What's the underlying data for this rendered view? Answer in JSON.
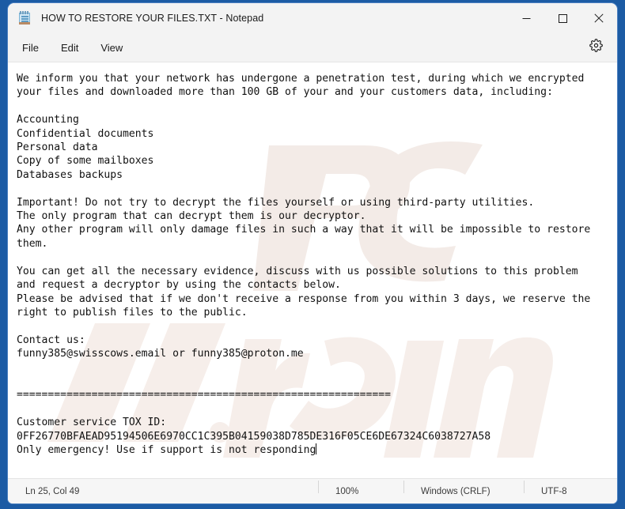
{
  "window": {
    "title": "HOW TO RESTORE YOUR FILES.TXT - Notepad",
    "app_icon": "notepad-icon",
    "controls": {
      "minimize": "minimize-icon",
      "maximize": "maximize-icon",
      "close": "close-icon"
    }
  },
  "menubar": {
    "items": [
      {
        "label": "File"
      },
      {
        "label": "Edit"
      },
      {
        "label": "View"
      }
    ],
    "settings_icon": "gear-icon"
  },
  "watermark": {
    "logo": "PC",
    "text": "risk.com",
    "color": "#f2ece9"
  },
  "document": {
    "lines": [
      "We inform you that your network has undergone a penetration test, during which we encrypted",
      "your files and downloaded more than 100 GB of your and your customers data, including:",
      "",
      "Accounting",
      "Confidential documents",
      "Personal data",
      "Copy of some mailboxes",
      "Databases backups",
      "",
      "Important! Do not try to decrypt the files yourself or using third-party utilities.",
      "The only program that can decrypt them is our decryptor.",
      "Any other program will only damage files in such a way that it will be impossible to restore",
      "them.",
      "",
      "You can get all the necessary evidence, discuss with us possible solutions to this problem",
      "and request a decryptor by using the contacts below.",
      "Please be advised that if we don't receive a response from you within 3 days, we reserve the",
      "right to publish files to the public.",
      "",
      "Contact us:",
      "funny385@swisscows.email or funny385@proton.me",
      "",
      "",
      "============================================================",
      "",
      "Customer service TOX ID:",
      "0FF26770BFAEAD95194506E6970CC1C395B04159038D785DE316F05CE6DE67324C6038727A58",
      "Only emergency! Use if support is not responding"
    ]
  },
  "statusbar": {
    "position": "Ln 25, Col 49",
    "zoom": "100%",
    "line_ending": "Windows (CRLF)",
    "encoding": "UTF-8"
  }
}
